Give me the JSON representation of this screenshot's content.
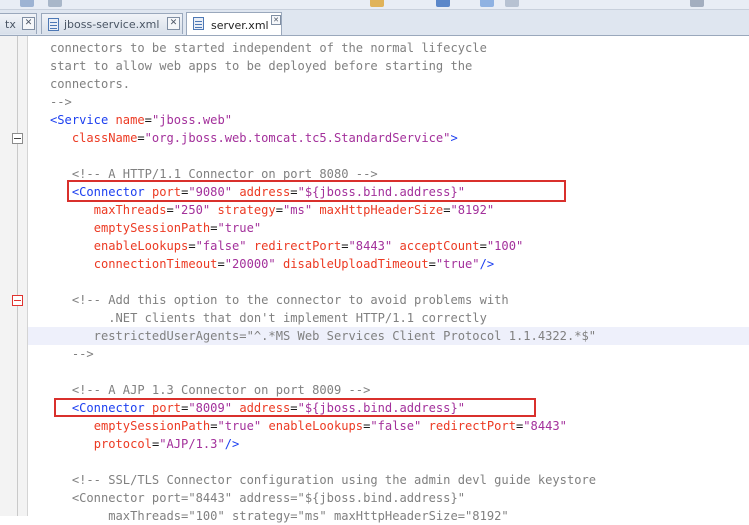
{
  "tabs": [
    {
      "label": "tx",
      "active": false
    },
    {
      "label": "jboss-service.xml",
      "active": false
    },
    {
      "label": "server.xml",
      "active": true
    }
  ],
  "colors": {
    "comment": "#808080",
    "tag": "#1c3ff0",
    "attribute": "#ec3a23",
    "value": "#a3309b",
    "highlight_box": "#d9302c",
    "current_line": "#eef0fb"
  },
  "code_lines": [
    [
      {
        "k": "c",
        "s": "connectors to be started independent of the normal lifecycle"
      }
    ],
    [
      {
        "k": "c",
        "s": "start to allow web apps to be deployed before starting the"
      }
    ],
    [
      {
        "k": "c",
        "s": "connectors."
      }
    ],
    [
      {
        "k": "c",
        "s": "-->"
      }
    ],
    [
      {
        "k": "t",
        "s": "<Service"
      },
      {
        "k": "p",
        "s": " "
      },
      {
        "k": "a",
        "s": "name"
      },
      {
        "k": "p",
        "s": "="
      },
      {
        "k": "v",
        "s": "\"jboss.web\""
      }
    ],
    [
      {
        "k": "p",
        "s": "   "
      },
      {
        "k": "a",
        "s": "className"
      },
      {
        "k": "p",
        "s": "="
      },
      {
        "k": "v",
        "s": "\"org.jboss.web.tomcat.tc5.StandardService\""
      },
      {
        "k": "t",
        "s": ">"
      }
    ],
    [],
    [
      {
        "k": "p",
        "s": "   "
      },
      {
        "k": "c",
        "s": "<!-- A HTTP/1.1 Connector on port 8080 -->"
      }
    ],
    [
      {
        "k": "p",
        "s": "   "
      },
      {
        "k": "t",
        "s": "<Connector"
      },
      {
        "k": "p",
        "s": " "
      },
      {
        "k": "a",
        "s": "port"
      },
      {
        "k": "p",
        "s": "="
      },
      {
        "k": "v",
        "s": "\"9080\""
      },
      {
        "k": "p",
        "s": " "
      },
      {
        "k": "a",
        "s": "address"
      },
      {
        "k": "p",
        "s": "="
      },
      {
        "k": "v",
        "s": "\"${jboss.bind.address}\""
      }
    ],
    [
      {
        "k": "p",
        "s": "      "
      },
      {
        "k": "a",
        "s": "maxThreads"
      },
      {
        "k": "p",
        "s": "="
      },
      {
        "k": "v",
        "s": "\"250\""
      },
      {
        "k": "p",
        "s": " "
      },
      {
        "k": "a",
        "s": "strategy"
      },
      {
        "k": "p",
        "s": "="
      },
      {
        "k": "v",
        "s": "\"ms\""
      },
      {
        "k": "p",
        "s": " "
      },
      {
        "k": "a",
        "s": "maxHttpHeaderSize"
      },
      {
        "k": "p",
        "s": "="
      },
      {
        "k": "v",
        "s": "\"8192\""
      }
    ],
    [
      {
        "k": "p",
        "s": "      "
      },
      {
        "k": "a",
        "s": "emptySessionPath"
      },
      {
        "k": "p",
        "s": "="
      },
      {
        "k": "v",
        "s": "\"true\""
      }
    ],
    [
      {
        "k": "p",
        "s": "      "
      },
      {
        "k": "a",
        "s": "enableLookups"
      },
      {
        "k": "p",
        "s": "="
      },
      {
        "k": "v",
        "s": "\"false\""
      },
      {
        "k": "p",
        "s": " "
      },
      {
        "k": "a",
        "s": "redirectPort"
      },
      {
        "k": "p",
        "s": "="
      },
      {
        "k": "v",
        "s": "\"8443\""
      },
      {
        "k": "p",
        "s": " "
      },
      {
        "k": "a",
        "s": "acceptCount"
      },
      {
        "k": "p",
        "s": "="
      },
      {
        "k": "v",
        "s": "\"100\""
      }
    ],
    [
      {
        "k": "p",
        "s": "      "
      },
      {
        "k": "a",
        "s": "connectionTimeout"
      },
      {
        "k": "p",
        "s": "="
      },
      {
        "k": "v",
        "s": "\"20000\""
      },
      {
        "k": "p",
        "s": " "
      },
      {
        "k": "a",
        "s": "disableUploadTimeout"
      },
      {
        "k": "p",
        "s": "="
      },
      {
        "k": "v",
        "s": "\"true\""
      },
      {
        "k": "t",
        "s": "/>"
      }
    ],
    [],
    [
      {
        "k": "p",
        "s": "   "
      },
      {
        "k": "c",
        "s": "<!-- Add this option to the connector to avoid problems with"
      }
    ],
    [
      {
        "k": "c",
        "s": "        .NET clients that don't implement HTTP/1.1 correctly"
      }
    ],
    [
      {
        "k": "c",
        "s": "      restrictedUserAgents=\"^.*MS Web Services Client Protocol 1.1.4322.*$\""
      }
    ],
    [
      {
        "k": "c",
        "s": "   -->"
      }
    ],
    [],
    [
      {
        "k": "p",
        "s": "   "
      },
      {
        "k": "c",
        "s": "<!-- A AJP 1.3 Connector on port 8009 -->"
      }
    ],
    [
      {
        "k": "p",
        "s": "   "
      },
      {
        "k": "t",
        "s": "<Connector"
      },
      {
        "k": "p",
        "s": " "
      },
      {
        "k": "a",
        "s": "port"
      },
      {
        "k": "p",
        "s": "="
      },
      {
        "k": "v",
        "s": "\"8009\""
      },
      {
        "k": "p",
        "s": " "
      },
      {
        "k": "a",
        "s": "address"
      },
      {
        "k": "p",
        "s": "="
      },
      {
        "k": "v",
        "s": "\"${jboss.bind.address}\""
      }
    ],
    [
      {
        "k": "p",
        "s": "      "
      },
      {
        "k": "a",
        "s": "emptySessionPath"
      },
      {
        "k": "p",
        "s": "="
      },
      {
        "k": "v",
        "s": "\"true\""
      },
      {
        "k": "p",
        "s": " "
      },
      {
        "k": "a",
        "s": "enableLookups"
      },
      {
        "k": "p",
        "s": "="
      },
      {
        "k": "v",
        "s": "\"false\""
      },
      {
        "k": "p",
        "s": " "
      },
      {
        "k": "a",
        "s": "redirectPort"
      },
      {
        "k": "p",
        "s": "="
      },
      {
        "k": "v",
        "s": "\"8443\""
      }
    ],
    [
      {
        "k": "p",
        "s": "      "
      },
      {
        "k": "a",
        "s": "protocol"
      },
      {
        "k": "p",
        "s": "="
      },
      {
        "k": "v",
        "s": "\"AJP/1.3\""
      },
      {
        "k": "t",
        "s": "/>"
      }
    ],
    [],
    [
      {
        "k": "p",
        "s": "   "
      },
      {
        "k": "c",
        "s": "<!-- SSL/TLS Connector configuration using the admin devl guide keystore"
      }
    ],
    [
      {
        "k": "c",
        "s": "   <Connector port=\"8443\" address=\"${jboss.bind.address}\""
      }
    ],
    [
      {
        "k": "c",
        "s": "        maxThreads=\"100\" strategy=\"ms\" maxHttpHeaderSize=\"8192\""
      }
    ]
  ]
}
